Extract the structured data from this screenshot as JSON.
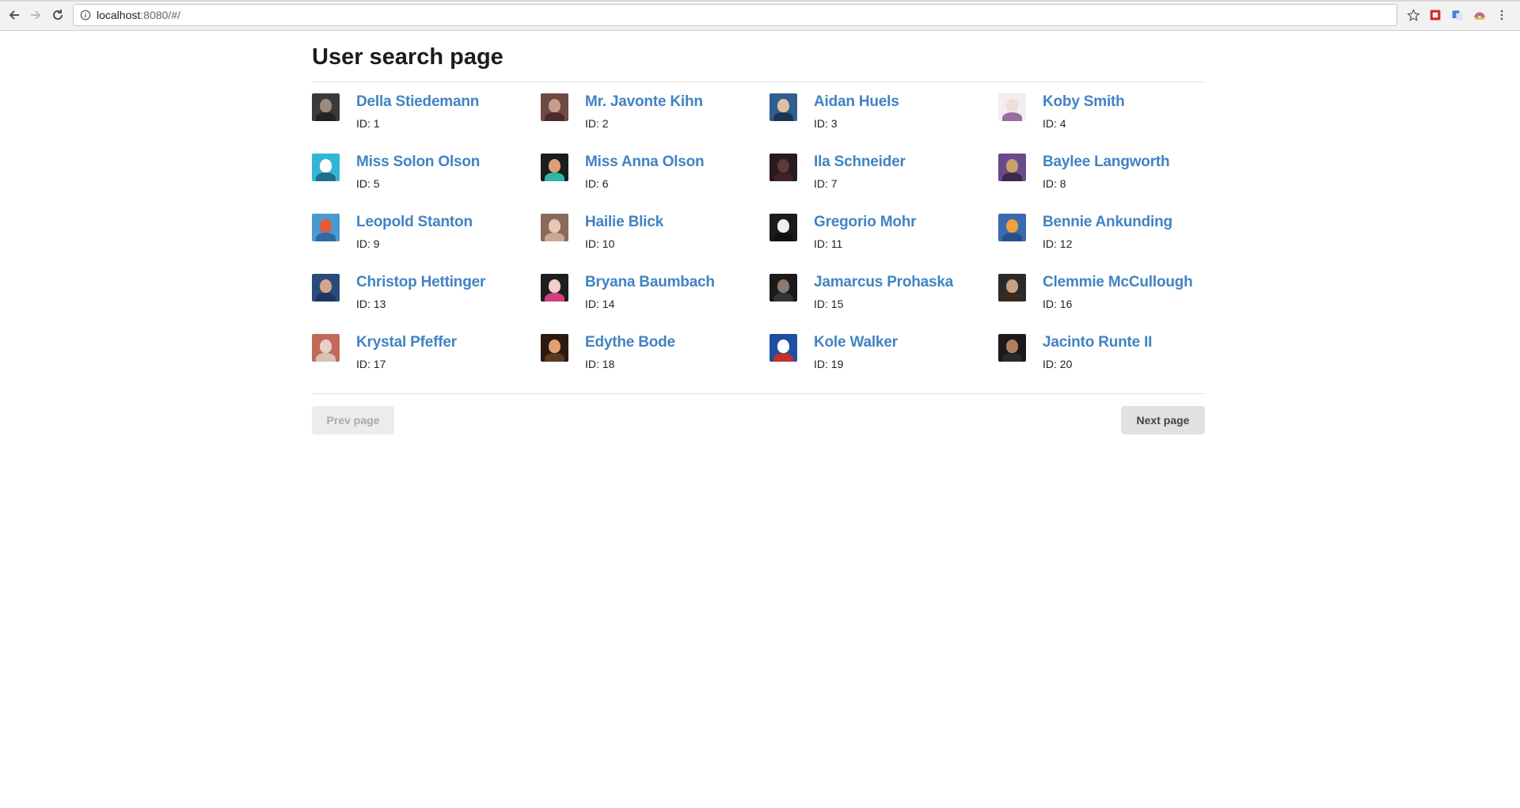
{
  "browser": {
    "url_host": "localhost",
    "url_rest": ":8080/#/"
  },
  "page": {
    "title": "User search page"
  },
  "users": [
    {
      "name": "Della Stiedemann",
      "id": "ID: 1",
      "skin": "#9a8b80",
      "bg": "#3a3a3a",
      "shirt": "#222222"
    },
    {
      "name": "Mr. Javonte Kihn",
      "id": "ID: 2",
      "skin": "#c99b8e",
      "bg": "#6e4a45",
      "shirt": "#4a2a2a"
    },
    {
      "name": "Aidan Huels",
      "id": "ID: 3",
      "skin": "#e0c0a0",
      "bg": "#2f5f8f",
      "shirt": "#1c3553"
    },
    {
      "name": "Koby Smith",
      "id": "ID: 4",
      "skin": "#f0dcd8",
      "bg": "#f2eef0",
      "shirt": "#9a6d9a"
    },
    {
      "name": "Miss Solon Olson",
      "id": "ID: 5",
      "skin": "#ffffff",
      "bg": "#33b5d6",
      "shirt": "#1d6f8a"
    },
    {
      "name": "Miss Anna Olson",
      "id": "ID: 6",
      "skin": "#d9a07a",
      "bg": "#1c1c1c",
      "shirt": "#2fb5a6"
    },
    {
      "name": "Ila Schneider",
      "id": "ID: 7",
      "skin": "#5a3a3a",
      "bg": "#2a1a1f",
      "shirt": "#3d2028"
    },
    {
      "name": "Baylee Langworth",
      "id": "ID: 8",
      "skin": "#c9a26a",
      "bg": "#6a4b8a",
      "shirt": "#3b2a4d"
    },
    {
      "name": "Leopold Stanton",
      "id": "ID: 9",
      "skin": "#e25a3a",
      "bg": "#4a9ad0",
      "shirt": "#2f6aa0"
    },
    {
      "name": "Hailie Blick",
      "id": "ID: 10",
      "skin": "#e6c8b6",
      "bg": "#8a6a5a",
      "shirt": "#c9a896"
    },
    {
      "name": "Gregorio Mohr",
      "id": "ID: 11",
      "skin": "#f0f0f0",
      "bg": "#1b1b1b",
      "shirt": "#111111"
    },
    {
      "name": "Bennie Ankunding",
      "id": "ID: 12",
      "skin": "#f0a040",
      "bg": "#3a6ab0",
      "shirt": "#274f8a"
    },
    {
      "name": "Christop Hettinger",
      "id": "ID: 13",
      "skin": "#d7a58a",
      "bg": "#2a4a7a",
      "shirt": "#1e3560"
    },
    {
      "name": "Bryana Baumbach",
      "id": "ID: 14",
      "skin": "#f0d0c8",
      "bg": "#1e1e1e",
      "shirt": "#d04080"
    },
    {
      "name": "Jamarcus Prohaska",
      "id": "ID: 15",
      "skin": "#8a7a70",
      "bg": "#1a1a1a",
      "shirt": "#333333"
    },
    {
      "name": "Clemmie McCullough",
      "id": "ID: 16",
      "skin": "#c8a080",
      "bg": "#2a2a2a",
      "shirt": "#3a2a1a"
    },
    {
      "name": "Krystal Pfeffer",
      "id": "ID: 17",
      "skin": "#e8d0c8",
      "bg": "#c06a5a",
      "shirt": "#d8c0b8"
    },
    {
      "name": "Edythe Bode",
      "id": "ID: 18",
      "skin": "#e0a070",
      "bg": "#2a1a10",
      "shirt": "#5a3a20"
    },
    {
      "name": "Kole Walker",
      "id": "ID: 19",
      "skin": "#ffffff",
      "bg": "#1f4fa0",
      "shirt": "#c03030"
    },
    {
      "name": "Jacinto Runte II",
      "id": "ID: 20",
      "skin": "#b08060",
      "bg": "#1a1a1a",
      "shirt": "#2a2a2a"
    }
  ],
  "pagination": {
    "prev_label": "Prev page",
    "next_label": "Next page"
  },
  "colors": {
    "link": "#4183c4",
    "title": "#1b1c1d"
  }
}
